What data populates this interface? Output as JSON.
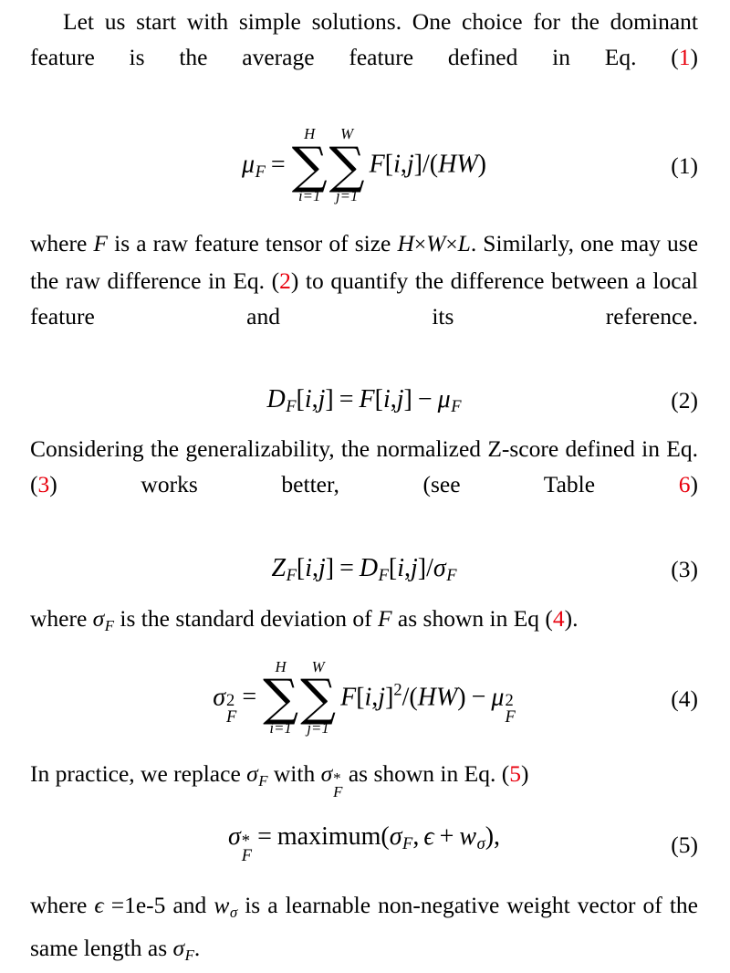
{
  "document": {
    "type": "academic-paper-excerpt",
    "colors": {
      "text": "#000000",
      "reference_red": "#e8000d",
      "background": "#ffffff"
    },
    "paragraphs": {
      "p1": {
        "seg1": "Let us start with simple solutions.  One choice for the dominant feature is the average feature defined in Eq. (",
        "ref": "1",
        "seg2": ")"
      },
      "p2": {
        "seg1": "where ",
        "var_F": "F",
        "seg2": " is a raw feature tensor of size ",
        "var_H": "H",
        "times1": "×",
        "var_W": "W",
        "times2": "×",
        "var_L": "L",
        "seg3": ". Similarly, one may use the raw difference in Eq. (",
        "ref": "2",
        "seg4": ") to quantify the difference between a local feature and its reference."
      },
      "p3": {
        "seg1": "Considering the generalizability, the normalized Z-score defined in Eq. (",
        "ref1": "3",
        "seg2": ") works better, (see Table ",
        "ref2": "6",
        "seg3": ")"
      },
      "p4": {
        "seg1": "where ",
        "sigma": "σ",
        "sigma_sub": "F",
        "seg2": " is the standard deviation of ",
        "var_F": "F",
        "seg3": " as shown in Eq (",
        "ref": "4",
        "seg4": ")."
      },
      "p5": {
        "seg1": "In practice, we replace ",
        "sigma": "σ",
        "sigma_sub": "F",
        "seg2": " with ",
        "sigma_star": "σ",
        "sigma_star_sup": "*",
        "sigma_star_sub": "F",
        "seg3": " as shown in Eq. (",
        "ref": "5",
        "seg4": ")"
      },
      "p6": {
        "seg1": "where ",
        "epsilon": "ϵ",
        "seg2": " =1e-5 and ",
        "w": "w",
        "w_sub": "σ",
        "seg3": " is a learnable non-negative weight vector of the same length as ",
        "sigma": "σ",
        "sigma_sub": "F",
        "seg4": "."
      }
    },
    "equations": {
      "eq1": {
        "number": "(1)",
        "lhs_var": "μ",
        "lhs_sub": "F",
        "equals": "=",
        "sum1": {
          "upper": "H",
          "symbol": "∑",
          "lower": "i=1"
        },
        "sum2": {
          "upper": "W",
          "symbol": "∑",
          "lower": "j=1"
        },
        "body_var": "F",
        "bracket_open": "[",
        "idx_i": "i",
        "comma": ",",
        "idx_j": "j",
        "bracket_close": "]",
        "slash": "/",
        "paren_open": "(",
        "HW": "HW",
        "paren_close": ")",
        "latex": "\\mu_F = \\sum_{i=1}^{H}\\sum_{j=1}^{W} F[i,j]/(HW)"
      },
      "eq2": {
        "number": "(2)",
        "lhs_var": "D",
        "lhs_sub": "F",
        "bracket_open": "[",
        "idx_i": "i",
        "comma": ",",
        "idx_j": "j",
        "bracket_close": "]",
        "equals": "=",
        "rhs_var": "F",
        "minus": "−",
        "mu": "μ",
        "mu_sub": "F",
        "latex": "D_F[i,j] = F[i,j] - \\mu_F"
      },
      "eq3": {
        "number": "(3)",
        "lhs_var": "Z",
        "lhs_sub": "F",
        "bracket_open": "[",
        "idx_i": "i",
        "comma": ",",
        "idx_j": "j",
        "bracket_close": "]",
        "equals": "=",
        "rhs_var": "D",
        "rhs_sub": "F",
        "slash": "/",
        "sigma": "σ",
        "sigma_sub": "F",
        "latex": "Z_F[i,j] = D_F[i,j]/\\sigma_F"
      },
      "eq4": {
        "number": "(4)",
        "lhs_var": "σ",
        "lhs_sup": "2",
        "lhs_sub": "F",
        "equals": "=",
        "sum1": {
          "upper": "H",
          "symbol": "∑",
          "lower": "i=1"
        },
        "sum2": {
          "upper": "W",
          "symbol": "∑",
          "lower": "j=1"
        },
        "body_var": "F",
        "bracket_open": "[",
        "idx_i": "i",
        "comma": ",",
        "idx_j": "j",
        "bracket_close": "]",
        "body_sup": "2",
        "slash": "/",
        "paren_open": "(",
        "HW": "HW",
        "paren_close": ")",
        "minus": "−",
        "mu": "μ",
        "mu_sup": "2",
        "mu_sub": "F",
        "latex": "\\sigma_F^2 = \\sum_{i=1}^{H}\\sum_{j=1}^{W} F[i,j]^2/(HW) - \\mu_F^2"
      },
      "eq5": {
        "number": "(5)",
        "lhs_var": "σ",
        "lhs_sup": "*",
        "lhs_sub": "F",
        "equals": "=",
        "func": "maximum",
        "paren_open": "(",
        "sigma": "σ",
        "sigma_sub": "F",
        "comma": ",",
        "epsilon": "ϵ",
        "plus": "+",
        "w": "w",
        "w_sub": "σ",
        "paren_close": ")",
        "trailing_comma": ",",
        "latex": "\\sigma_F^* = \\mathrm{maximum}(\\sigma_F, \\epsilon + w_\\sigma),"
      }
    }
  }
}
